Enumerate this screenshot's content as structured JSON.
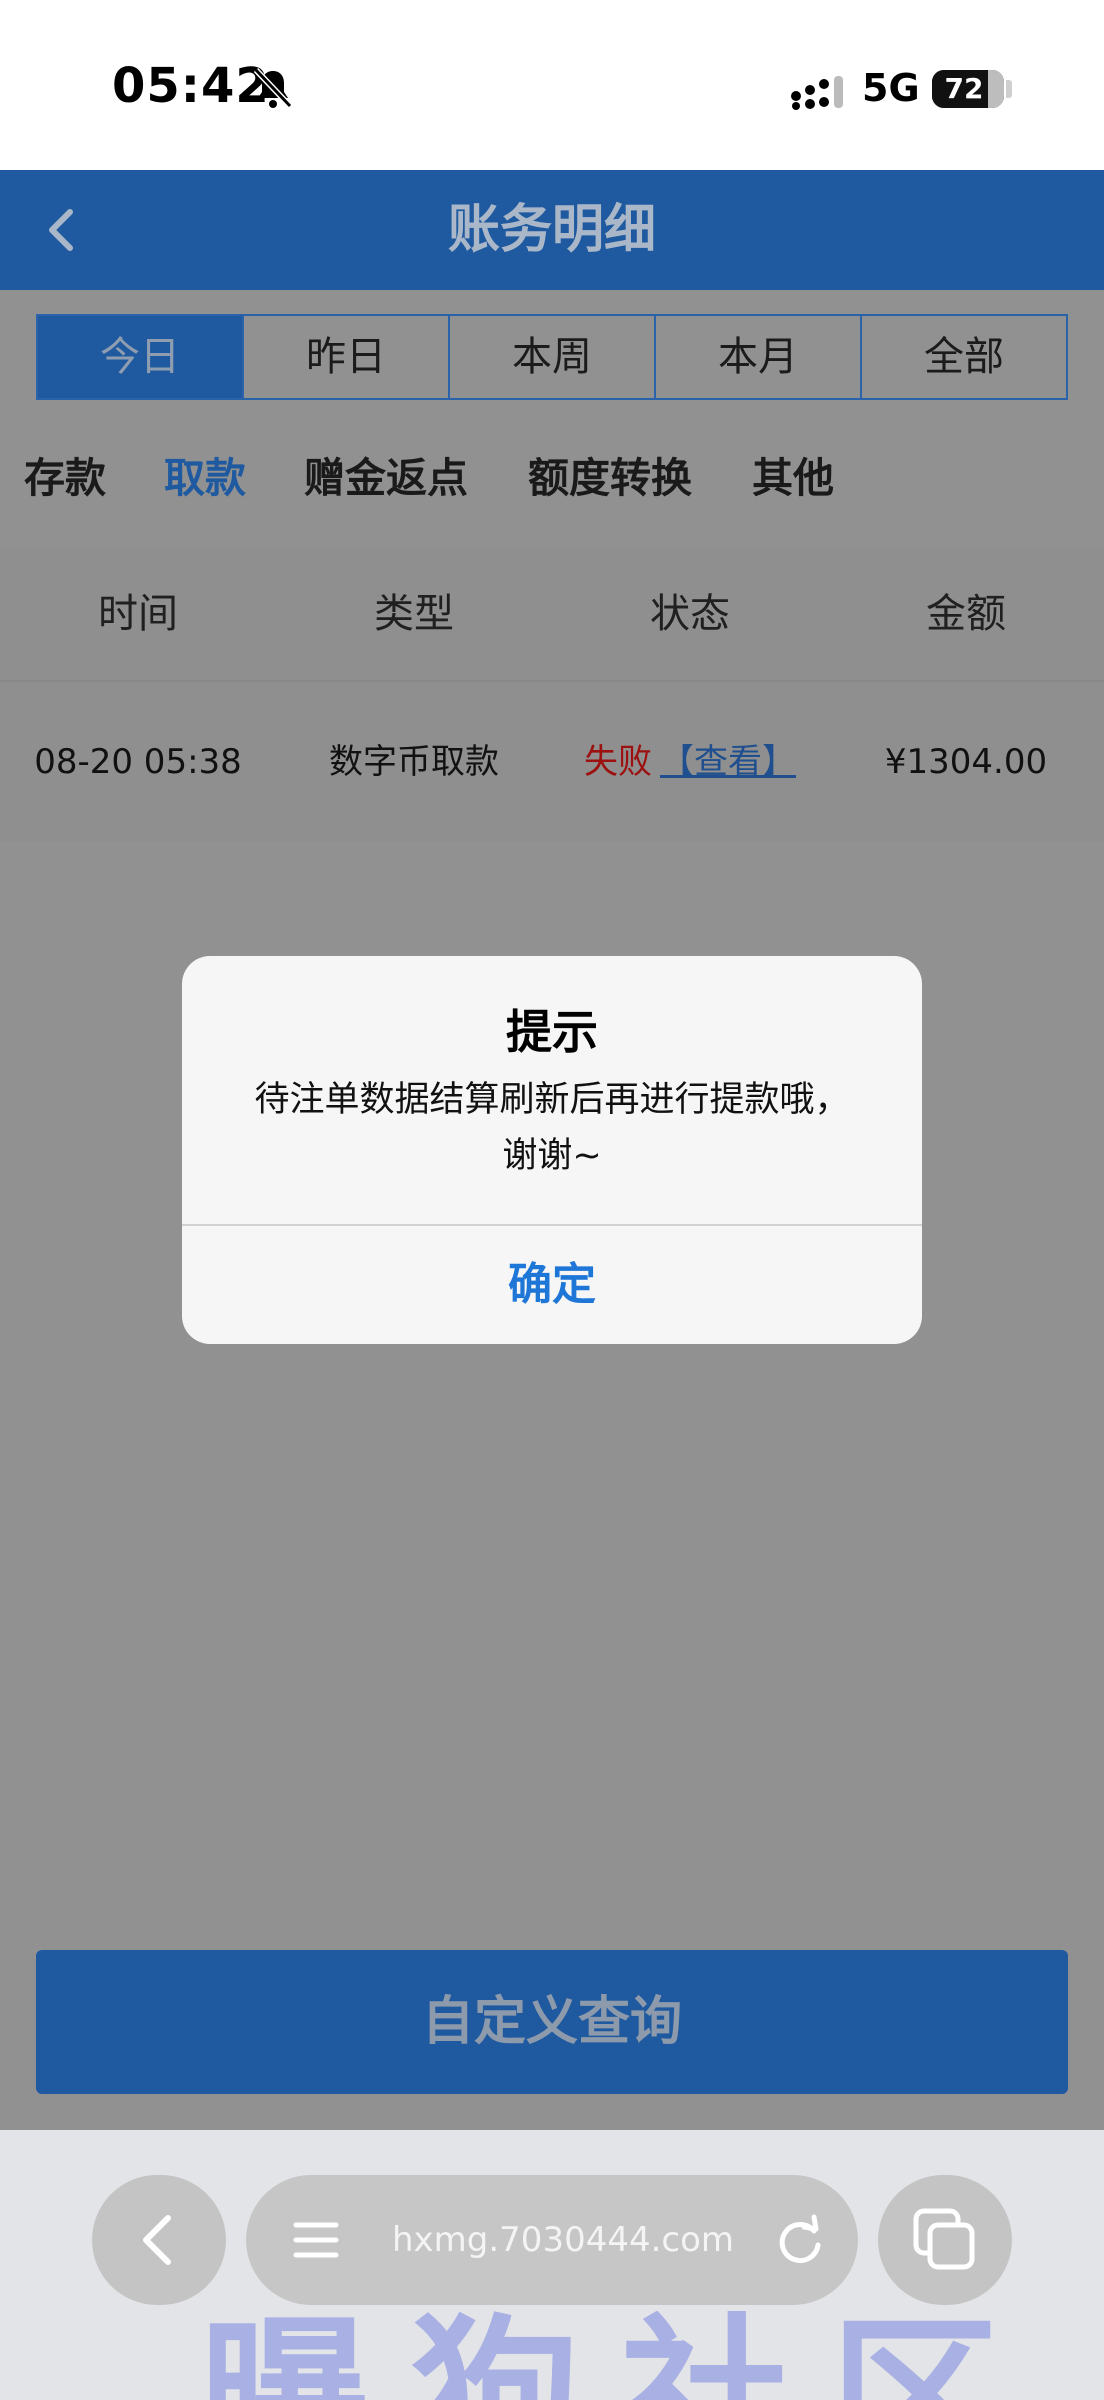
{
  "status_bar": {
    "time": "05:42",
    "network": "5G",
    "battery": "72"
  },
  "header": {
    "title": "账务明细"
  },
  "period_tabs": [
    "今日",
    "昨日",
    "本周",
    "本月",
    "全部"
  ],
  "category_tabs": [
    "存款",
    "取款",
    "赠金返点",
    "额度转换",
    "其他"
  ],
  "table": {
    "columns": [
      "时间",
      "类型",
      "状态",
      "金额"
    ],
    "rows": [
      {
        "time": "08-20 05:38",
        "type": "数字币取款",
        "status": "失败",
        "link": "【查看】",
        "amount": "¥1304.00"
      }
    ]
  },
  "query_button": "自定义查询",
  "modal": {
    "title": "提示",
    "message_line1": "待注单数据结算刷新后再进行提款哦，",
    "message_line2": "谢谢~",
    "confirm": "确定"
  },
  "browser": {
    "url": "hxmg.7030444.com"
  },
  "watermark": "曝狗社区",
  "colors": {
    "header": "#1f5aa0",
    "accent_blue": "#1e76d6",
    "failed_red": "#9c1010"
  }
}
